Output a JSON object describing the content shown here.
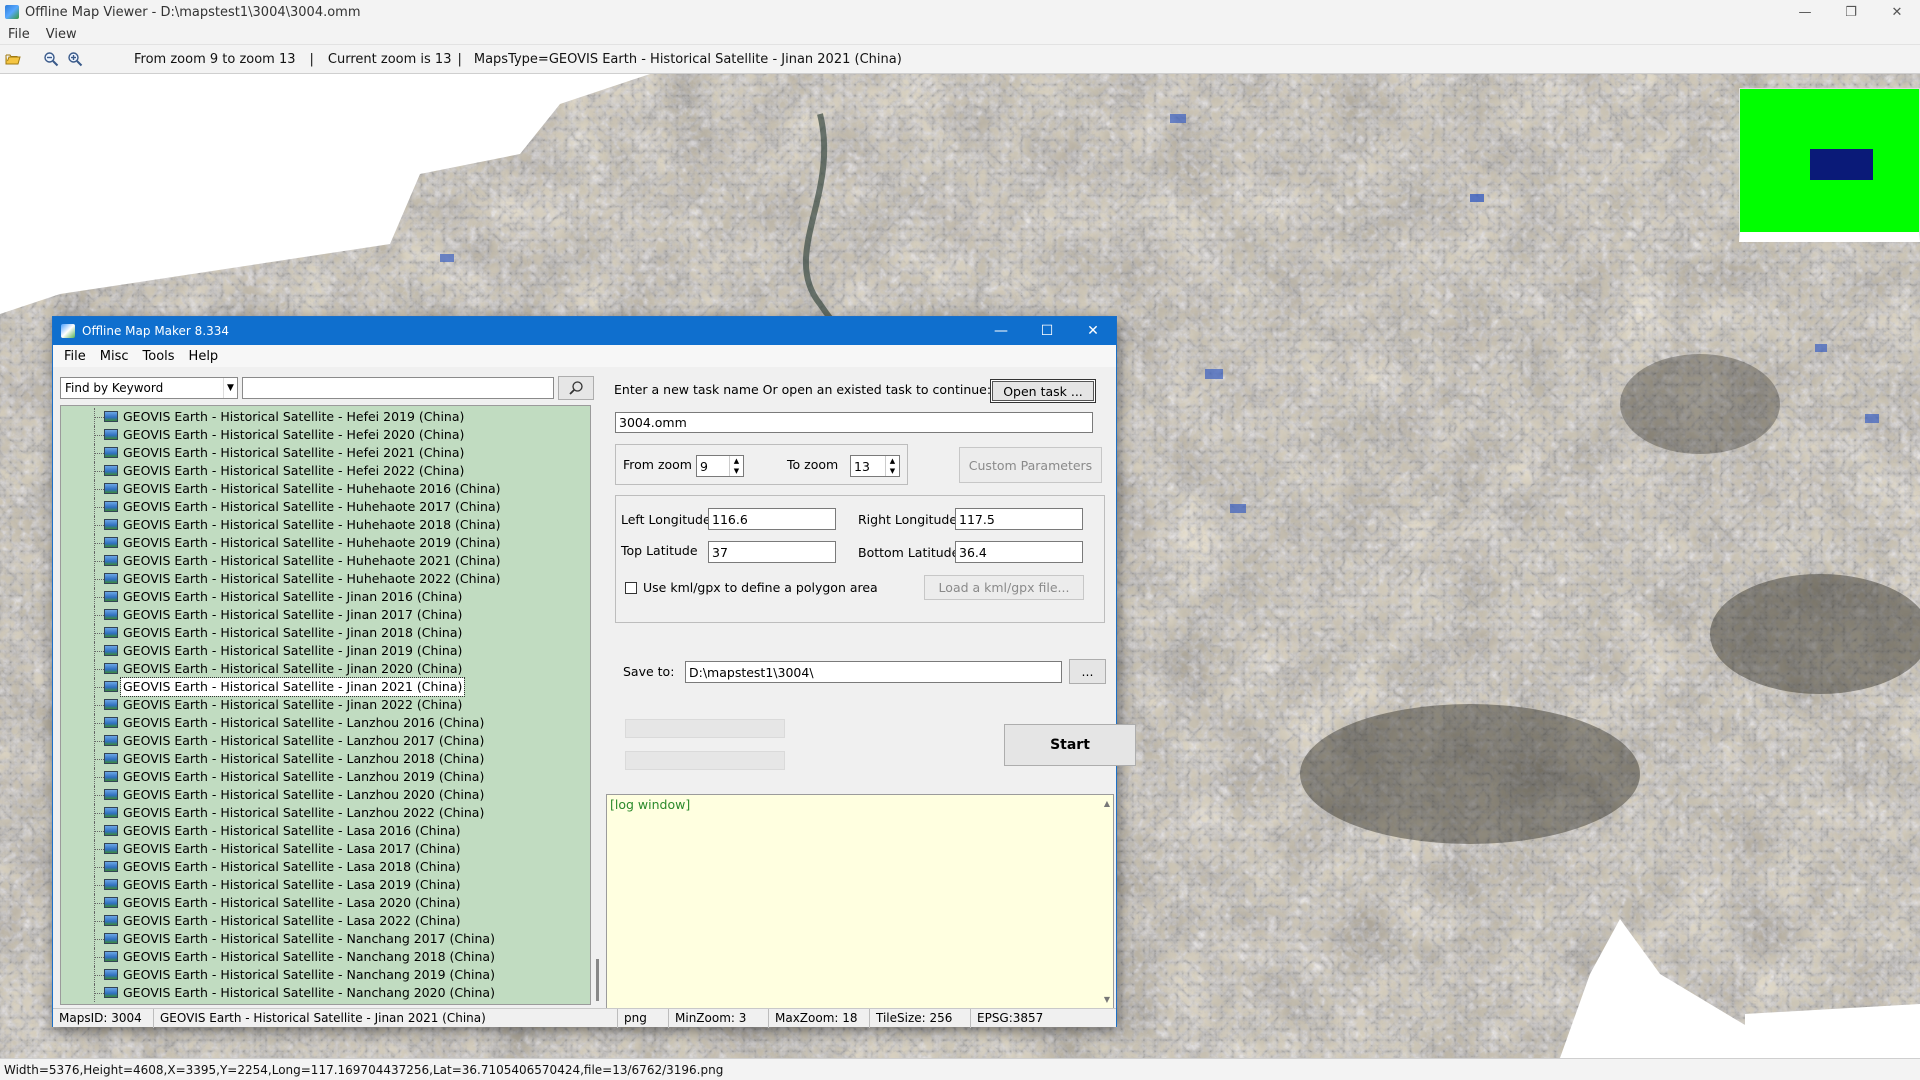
{
  "viewer": {
    "title": "Offline Map Viewer - D:\\mapstest1\\3004\\3004.omm",
    "window_controls": {
      "minimize": "—",
      "maximize": "❐",
      "close": "✕"
    },
    "menu": [
      "File",
      "View"
    ],
    "toolbar": {
      "open_icon": "folder-open-icon",
      "zoom_out_icon": "zoom-out-icon",
      "zoom_in_icon": "zoom-in-icon",
      "zoom_range": "From zoom 9 to zoom 13",
      "separator": "|",
      "current_zoom": "Current zoom is 13",
      "maps_type": "MapsType=GEOVIS Earth - Historical Satellite - Jinan 2021 (China)"
    },
    "status": "Width=5376,Height=4608,X=3395,Y=2254,Long=117.169704437256,Lat=36.7105406570424,file=13/6762/3196.png",
    "colors": {
      "minimap_bg": "#00ff00",
      "minimap_viewport": "#0a1a78"
    }
  },
  "dialog": {
    "title": "Offline Map Maker 8.334",
    "window_controls": {
      "minimize": "—",
      "maximize": "☐",
      "close": "✕"
    },
    "menu": [
      "File",
      "Misc",
      "Tools",
      "Help"
    ],
    "search": {
      "mode": "Find by Keyword",
      "keyword": "",
      "button_icon": "search-icon"
    },
    "tree_items": [
      "GEOVIS Earth - Historical Satellite - Hefei 2019 (China)",
      "GEOVIS Earth - Historical Satellite - Hefei 2020 (China)",
      "GEOVIS Earth - Historical Satellite - Hefei 2021 (China)",
      "GEOVIS Earth - Historical Satellite - Hefei 2022 (China)",
      "GEOVIS Earth - Historical Satellite - Huhehaote 2016 (China)",
      "GEOVIS Earth - Historical Satellite - Huhehaote 2017 (China)",
      "GEOVIS Earth - Historical Satellite - Huhehaote 2018 (China)",
      "GEOVIS Earth - Historical Satellite - Huhehaote 2019 (China)",
      "GEOVIS Earth - Historical Satellite - Huhehaote 2021 (China)",
      "GEOVIS Earth - Historical Satellite - Huhehaote 2022 (China)",
      "GEOVIS Earth - Historical Satellite - Jinan 2016 (China)",
      "GEOVIS Earth - Historical Satellite - Jinan 2017 (China)",
      "GEOVIS Earth - Historical Satellite - Jinan 2018 (China)",
      "GEOVIS Earth - Historical Satellite - Jinan 2019 (China)",
      "GEOVIS Earth - Historical Satellite - Jinan 2020 (China)",
      "GEOVIS Earth - Historical Satellite - Jinan 2021 (China)",
      "GEOVIS Earth - Historical Satellite - Jinan 2022 (China)",
      "GEOVIS Earth - Historical Satellite - Lanzhou 2016 (China)",
      "GEOVIS Earth - Historical Satellite - Lanzhou 2017 (China)",
      "GEOVIS Earth - Historical Satellite - Lanzhou 2018 (China)",
      "GEOVIS Earth - Historical Satellite - Lanzhou 2019 (China)",
      "GEOVIS Earth - Historical Satellite - Lanzhou 2020 (China)",
      "GEOVIS Earth - Historical Satellite - Lanzhou 2022 (China)",
      "GEOVIS Earth - Historical Satellite - Lasa 2016 (China)",
      "GEOVIS Earth - Historical Satellite - Lasa 2017 (China)",
      "GEOVIS Earth - Historical Satellite - Lasa 2018 (China)",
      "GEOVIS Earth - Historical Satellite - Lasa 2019 (China)",
      "GEOVIS Earth - Historical Satellite - Lasa 2020 (China)",
      "GEOVIS Earth - Historical Satellite - Lasa 2022 (China)",
      "GEOVIS Earth - Historical Satellite - Nanchang 2017 (China)",
      "GEOVIS Earth - Historical Satellite - Nanchang 2018 (China)",
      "GEOVIS Earth - Historical Satellite - Nanchang 2019 (China)",
      "GEOVIS Earth - Historical Satellite - Nanchang 2020 (China)"
    ],
    "selected_item": "GEOVIS Earth - Historical Satellite - Jinan 2021 (China)",
    "task": {
      "prompt": "Enter a new task name Or open an existed task to continue:",
      "open_button": "Open task ...",
      "name": "3004.omm"
    },
    "zoom": {
      "from_label": "From zoom",
      "from_value": "9",
      "to_label": "To zoom",
      "to_value": "13",
      "custom_button": "Custom Parameters"
    },
    "bounds": {
      "left_lon_label": "Left Longitude",
      "left_lon": "116.6",
      "right_lon_label": "Right Longitude",
      "right_lon": "117.5",
      "top_lat_label": "Top Latitude",
      "top_lat": "37",
      "bottom_lat_label": "Bottom Latitude",
      "bottom_lat": "36.4",
      "kml_checkbox_label": "Use kml/gpx to define a polygon area",
      "kml_button": "Load a kml/gpx file..."
    },
    "save": {
      "label": "Save to:",
      "path": "D:\\mapstest1\\3004\\",
      "browse_button": "..."
    },
    "start_button": "Start",
    "log_text": "[log window]",
    "status": {
      "maps_id": "MapsID: 3004",
      "map_name": "GEOVIS Earth - Historical Satellite - Jinan 2021 (China)",
      "format": "png",
      "min_zoom": "MinZoom: 3",
      "max_zoom": "MaxZoom: 18",
      "tile_size": "TileSize: 256",
      "epsg": "EPSG:3857"
    }
  }
}
